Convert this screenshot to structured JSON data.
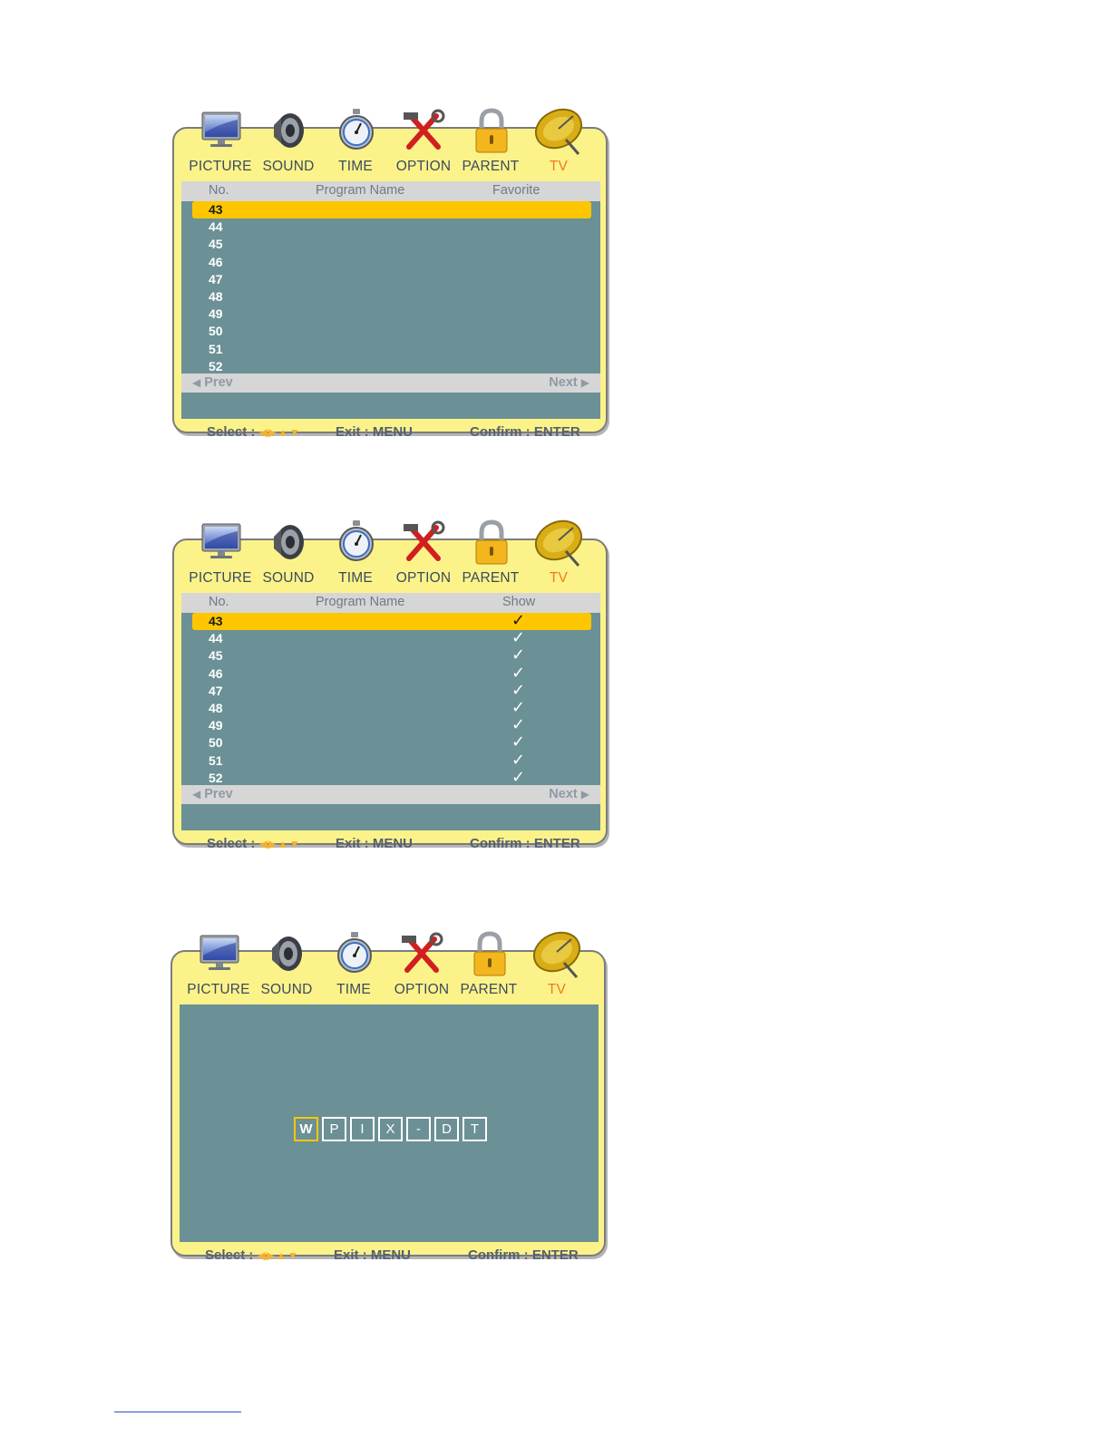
{
  "tabs": [
    {
      "label": "PICTURE",
      "icon": "monitor-icon"
    },
    {
      "label": "SOUND",
      "icon": "speaker-icon"
    },
    {
      "label": "TIME",
      "icon": "stopwatch-icon"
    },
    {
      "label": "OPTION",
      "icon": "tools-icon"
    },
    {
      "label": "PARENT",
      "icon": "padlock-icon"
    },
    {
      "label": "TV",
      "icon": "satellite-dish-icon",
      "active": true
    }
  ],
  "footer": {
    "select": "Select :",
    "select_arrows": "◀▶▲▼",
    "exit": "Exit : MENU",
    "confirm": "Confirm : ENTER"
  },
  "pager": {
    "prev": "Prev",
    "next": "Next",
    "prev_icon": "◀",
    "next_icon": "▶"
  },
  "screen1": {
    "headers": {
      "no": "No.",
      "name": "Program Name",
      "extra": "Favorite"
    },
    "rows": [
      "43",
      "44",
      "45",
      "46",
      "47",
      "48",
      "49",
      "50",
      "51",
      "52"
    ],
    "selected_index": 0
  },
  "screen2": {
    "headers": {
      "no": "No.",
      "name": "Program Name",
      "extra": "Show"
    },
    "rows": [
      "43",
      "44",
      "45",
      "46",
      "47",
      "48",
      "49",
      "50",
      "51",
      "52"
    ],
    "check_mark": "✓",
    "selected_index": 0
  },
  "screen3": {
    "chars": [
      "W",
      "P",
      "I",
      "X",
      "-",
      "D",
      "T"
    ],
    "cursor_index": 0
  },
  "colors": {
    "frame": "#fbf38a",
    "panel": "#6b9096",
    "header_bar": "#d6d6d6",
    "highlight": "#fec600",
    "active_tab": "#f07a1d",
    "tab_text": "#3c4a5e"
  }
}
